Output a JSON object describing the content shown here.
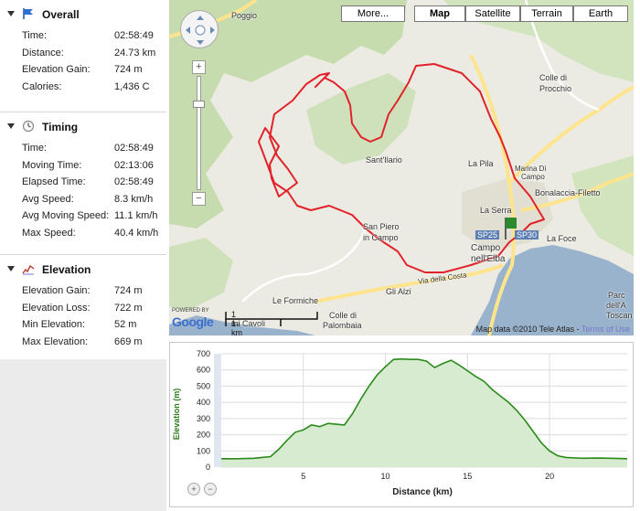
{
  "sidebar": {
    "overall": {
      "title": "Overall",
      "icon": "flag-icon",
      "rows": [
        {
          "label": "Time:",
          "value": "02:58:49"
        },
        {
          "label": "Distance:",
          "value": "24.73 km"
        },
        {
          "label": "Elevation Gain:",
          "value": "724 m"
        },
        {
          "label": "Calories:",
          "value": "1,436 C"
        }
      ]
    },
    "timing": {
      "title": "Timing",
      "icon": "clock-icon",
      "rows": [
        {
          "label": "Time:",
          "value": "02:58:49"
        },
        {
          "label": "Moving Time:",
          "value": "02:13:06"
        },
        {
          "label": "Elapsed Time:",
          "value": "02:58:49"
        },
        {
          "label": "Avg Speed:",
          "value": "8.3 km/h"
        },
        {
          "label": "Avg Moving Speed:",
          "value": "11.1 km/h"
        },
        {
          "label": "Max Speed:",
          "value": "40.4 km/h"
        }
      ]
    },
    "elevation": {
      "title": "Elevation",
      "icon": "elevation-graph-icon",
      "rows": [
        {
          "label": "Elevation Gain:",
          "value": "724 m"
        },
        {
          "label": "Elevation Loss:",
          "value": "722 m"
        },
        {
          "label": "Min Elevation:",
          "value": "52 m"
        },
        {
          "label": "Max Elevation:",
          "value": "669 m"
        }
      ]
    }
  },
  "map": {
    "map_types": [
      "More...",
      "Map",
      "Satellite",
      "Terrain",
      "Earth"
    ],
    "selected_type": "Map",
    "zoom_in": "+",
    "zoom_out": "−",
    "labels": [
      "Poggio",
      "Colle di",
      "Procchio",
      "Sant'Ilario",
      "La Pila",
      "Marina Di",
      "Campo",
      "Bonalaccia-Filetto",
      "La Serra",
      "SP25",
      "SP30",
      "Campo",
      "nell'Elba",
      "La Foce",
      "San Piero",
      "in Campo",
      "Via della Costa",
      "Gli Alzi",
      "Le Formiche",
      "Colle di",
      "Palombaia",
      "Cavoli",
      "Parc",
      "dell'A",
      "Toscan"
    ],
    "scale_mi": "1 mi",
    "scale_km": "1 km",
    "powered_by": "POWERED BY",
    "brand": "Google",
    "copyright": "Map data ©2010 Tele Atlas - ",
    "terms": "Terms of Use",
    "colors": {
      "route": "#e2222a",
      "sea": "#99b3cc",
      "forest": "#c6dcae",
      "road": "#fee48c"
    }
  },
  "chart_data": {
    "type": "area",
    "title": "",
    "xlabel": "Distance (km)",
    "ylabel": "Elevation (m)",
    "xlim": [
      0,
      24.73
    ],
    "ylim": [
      0,
      700
    ],
    "xticks": [
      5,
      10,
      15,
      20
    ],
    "yticks": [
      0,
      100,
      200,
      300,
      400,
      500,
      600,
      700
    ],
    "grid": true,
    "colors": {
      "line": "#2a8a1a",
      "fill": "#d7ebd0"
    },
    "x": [
      0,
      1,
      2,
      3,
      3.5,
      4,
      4.5,
      5,
      5.5,
      6,
      6.5,
      7,
      7.5,
      8,
      8.5,
      9,
      9.5,
      10,
      10.5,
      11,
      11.5,
      12,
      12.5,
      13,
      13.5,
      14,
      14.5,
      15,
      15.5,
      16,
      16.5,
      17,
      17.5,
      18,
      18.5,
      19,
      19.5,
      20,
      20.5,
      21,
      22,
      23,
      24,
      24.73
    ],
    "y": [
      52,
      52,
      55,
      65,
      110,
      165,
      215,
      230,
      260,
      250,
      270,
      265,
      260,
      330,
      420,
      500,
      570,
      620,
      665,
      668,
      665,
      665,
      655,
      615,
      640,
      660,
      630,
      595,
      560,
      530,
      480,
      440,
      400,
      350,
      290,
      220,
      150,
      100,
      70,
      60,
      55,
      56,
      54,
      52
    ]
  },
  "chart_controls": {
    "zoom_in": "+",
    "zoom_out": "−"
  }
}
